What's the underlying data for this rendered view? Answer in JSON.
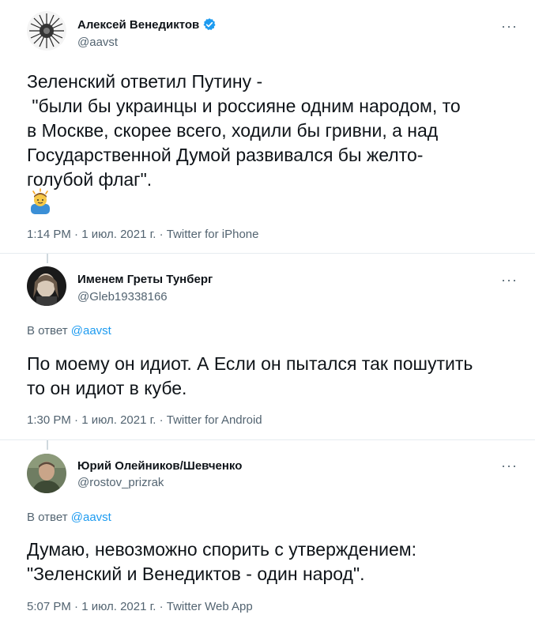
{
  "tweets": [
    {
      "name": "Алексей Венедиктов",
      "handle": "@aavst",
      "verified": true,
      "more_label": "···",
      "body_lines": [
        "Зеленский ответил Путину -",
        " \"были бы украинцы и россияне одним народом, то",
        "в Москве, скорее всего, ходили бы гривни, а над",
        "Государственной Думой развивался бы желто-",
        "голубой флаг\"."
      ],
      "emoji": "person-with-raised-hand-emoji",
      "meta": "1:14 PM · 1 июл. 2021 г. · Twitter for iPhone"
    },
    {
      "name": "Именем Греты Тунберг",
      "handle": "@Gleb19338166",
      "more_label": "···",
      "reply_prefix": "В ответ",
      "reply_to": "@aavst",
      "body_lines": [
        "По моему он идиот. А Если он пытался так пошутить",
        "то он идиот в кубе."
      ],
      "meta": "1:30 PM · 1 июл. 2021 г. · Twitter for Android"
    },
    {
      "name": "Юрий Олейников/Шевченко",
      "handle": "@rostov_prizrak",
      "more_label": "···",
      "reply_prefix": "В ответ",
      "reply_to": "@aavst",
      "body_lines": [
        "Думаю, невозможно спорить с утверждением:",
        "\"Зеленский и Венедиктов - один народ\"."
      ],
      "meta": "5:07 PM · 1 июл. 2021 г. · Twitter Web App"
    }
  ],
  "colors": {
    "accent": "#1d9bf0",
    "secondary_text": "#536471",
    "divider": "#e6ecf0"
  }
}
